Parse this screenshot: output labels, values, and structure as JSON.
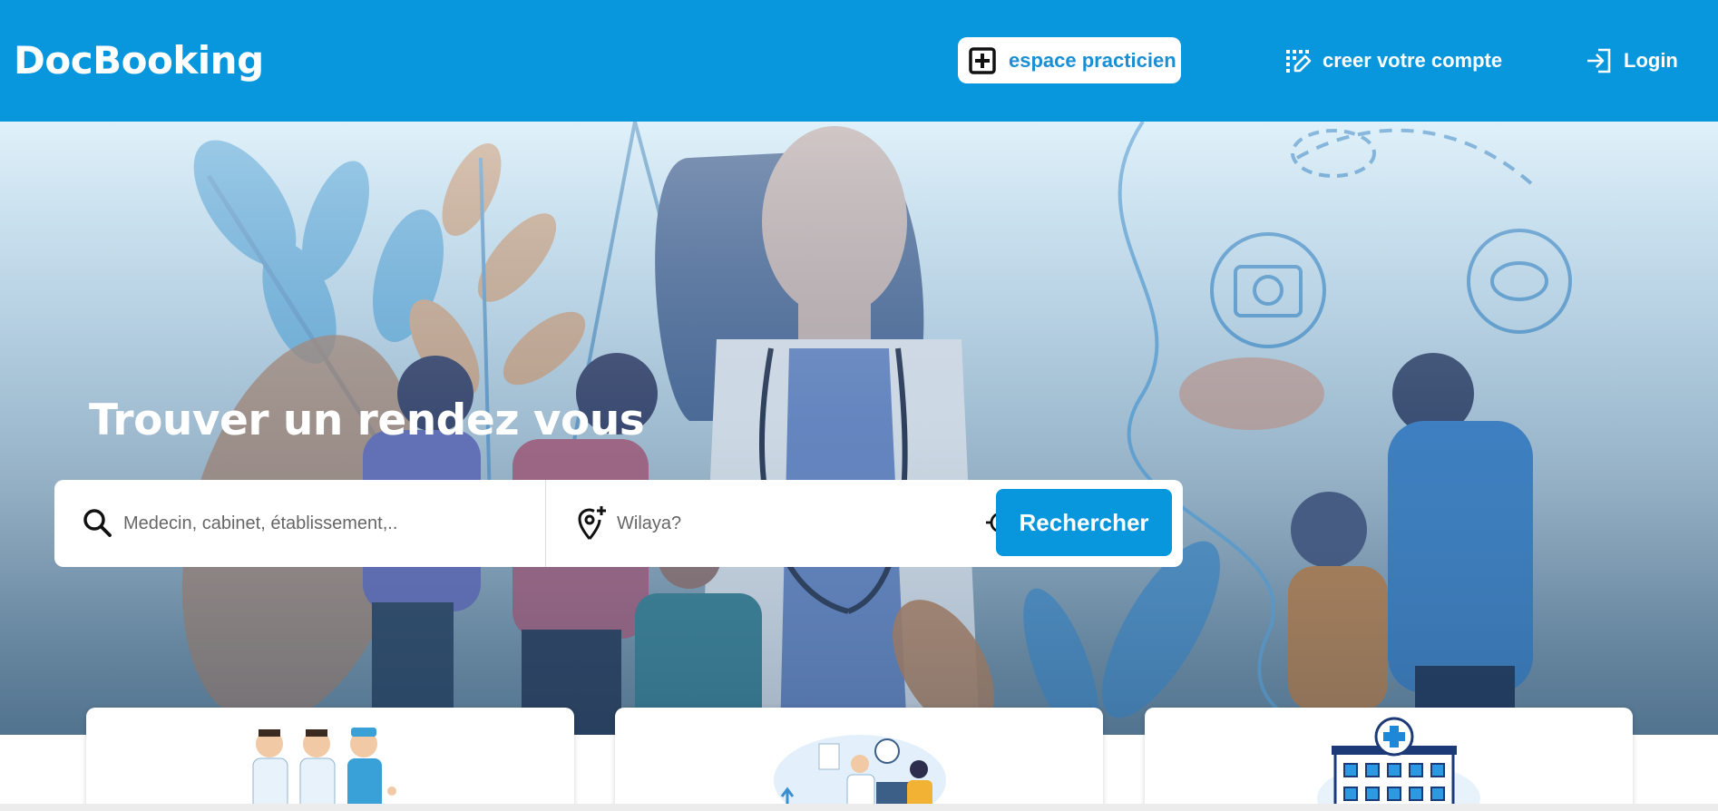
{
  "header": {
    "brand": "DocBooking",
    "practitioner_button": "espace practicien",
    "create_account_link": "creer votre compte",
    "login_link": "Login"
  },
  "hero": {
    "title": "Trouver un rendez vous"
  },
  "search": {
    "query_placeholder": "Medecin, cabinet, établissement,..",
    "query_value": "",
    "wilaya_placeholder": "Wilaya?",
    "wilaya_value": "",
    "button_label": "Rechercher"
  },
  "icons": {
    "practitioner": "plus-square-icon",
    "create_account": "edit-grid-icon",
    "login": "login-arrow-icon",
    "search": "search-icon",
    "location": "location-pin-plus-icon",
    "geolocate": "crosshair-target-icon"
  },
  "colors": {
    "primary": "#0896dd",
    "white": "#ffffff",
    "practitioner_text": "#1a8fd4"
  }
}
